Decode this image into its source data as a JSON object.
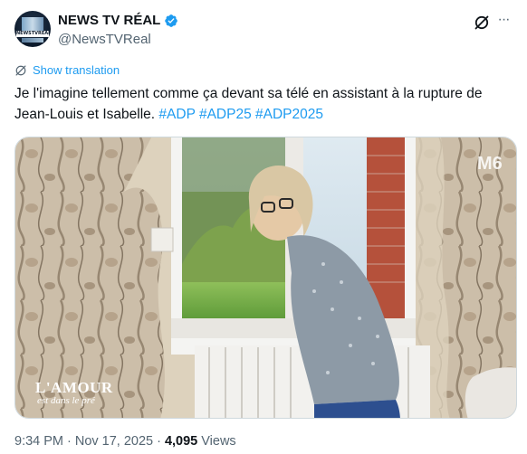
{
  "author": {
    "display_name": "NEWS TV RÉAL",
    "handle": "@NewsTVReal",
    "avatar_text": "NEWSTVREAL",
    "verified": true
  },
  "actions": {
    "grok_icon": "grok-icon",
    "more_icon": "more-icon",
    "more_label": "···"
  },
  "translation": {
    "label": "Show translation",
    "icon": "translate-icon"
  },
  "tweet": {
    "text": "Je l'imagine tellement comme ça devant sa télé en assistant à la rupture de Jean-Louis et Isabelle.",
    "hashtags": [
      "#ADP",
      "#ADP25",
      "#ADP2025"
    ]
  },
  "media": {
    "watermark_line1": "L'AMOUR",
    "watermark_line2": "est dans le pré",
    "channel_logo": "M6"
  },
  "meta": {
    "time": "9:34 PM",
    "separator": "·",
    "date": "Nov 17, 2025",
    "views_count": "4,095",
    "views_label": "Views"
  },
  "colors": {
    "accent": "#1d9bf0",
    "text": "#0f1419",
    "secondary": "#536471"
  }
}
